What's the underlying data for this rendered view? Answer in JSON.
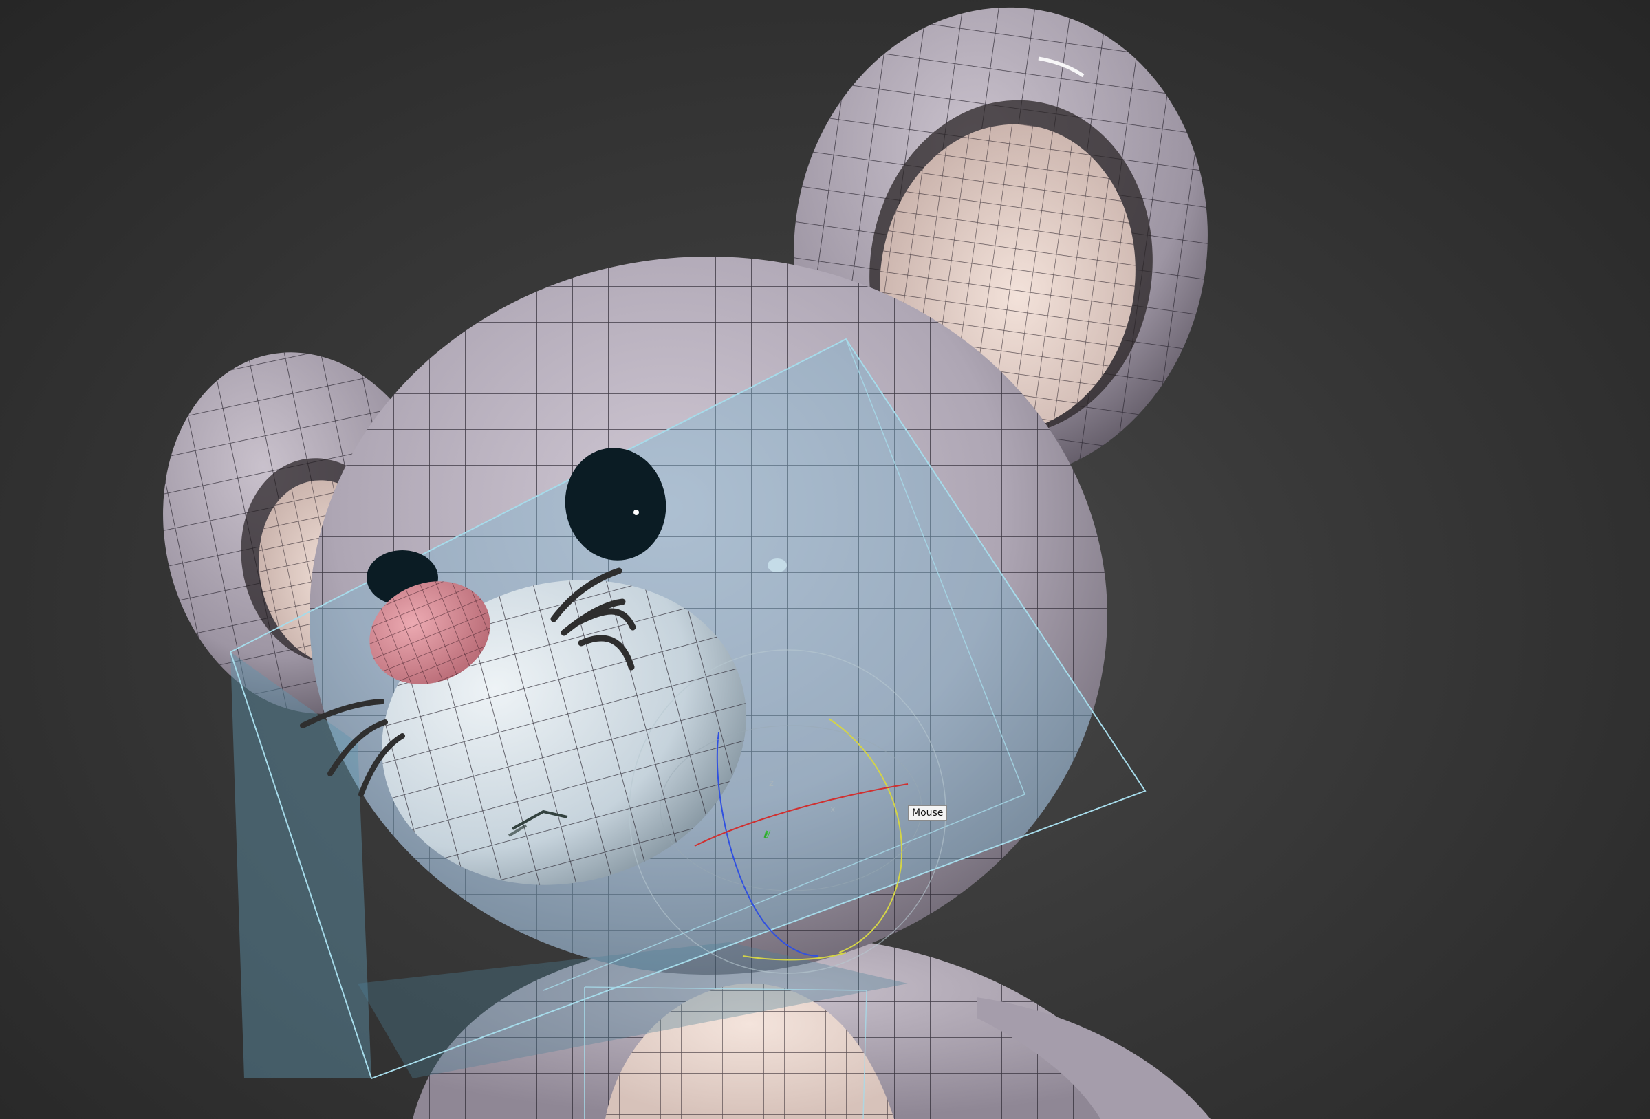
{
  "viewport": {
    "object_tooltip": "Mouse",
    "gizmo": {
      "axis_x_label": "x",
      "axis_y_label": "y",
      "axis_z_label": "z"
    },
    "colors": {
      "background": "#2e2e2e",
      "body": "#b5aeba",
      "inner_ear": "#ecd7cf",
      "nose": "#d98f98",
      "eye": "#0b1c24",
      "muzzle": "#d6e2ea",
      "selection_box": "#9fd4e6"
    }
  }
}
